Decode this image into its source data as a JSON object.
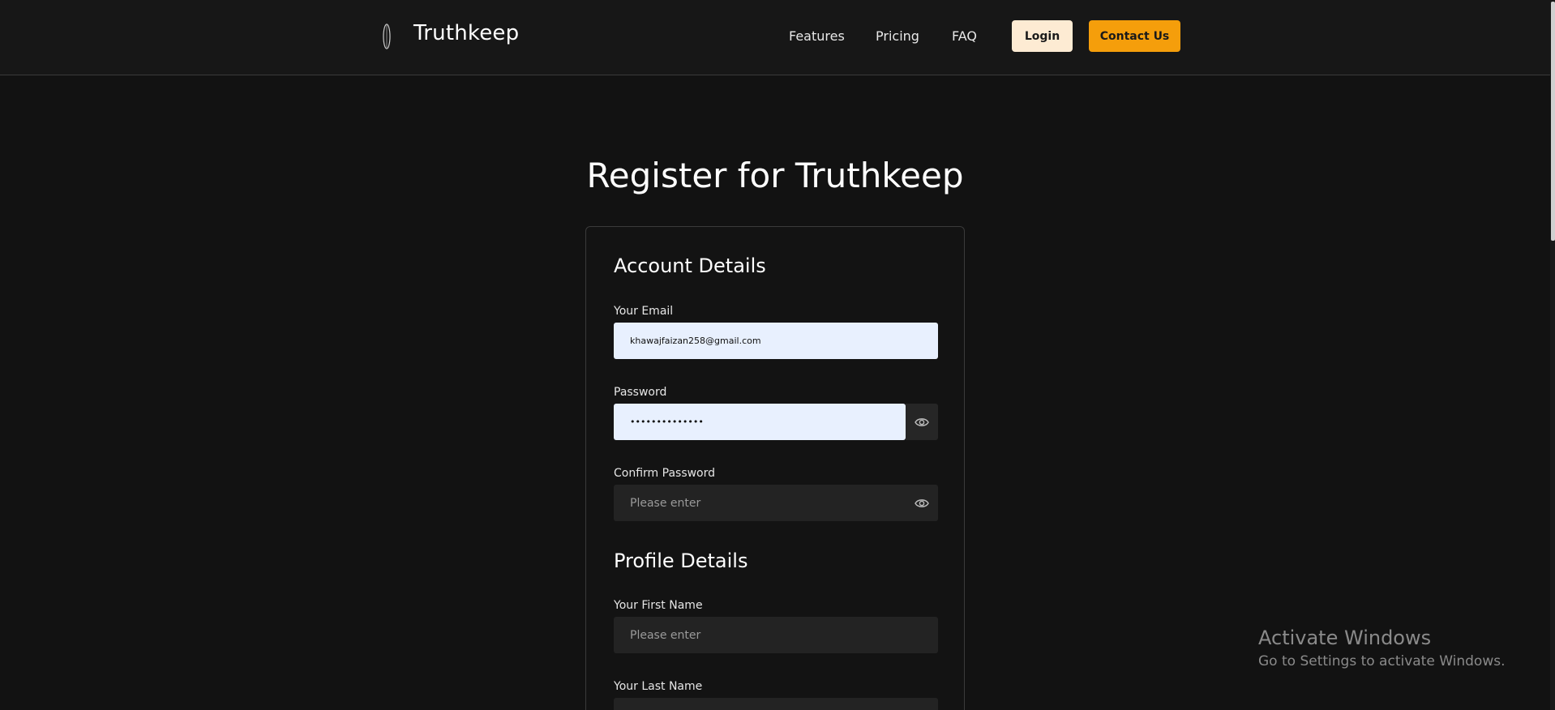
{
  "header": {
    "brand": "Truthkeep",
    "nav": [
      "Features",
      "Pricing",
      "FAQ"
    ],
    "login_label": "Login",
    "contact_label": "Contact Us"
  },
  "main": {
    "title": "Register for Truthkeep",
    "account_section": "Account Details",
    "email_label": "Your Email",
    "email_value": "khawajfaizan258@gmail.com",
    "password_label": "Password",
    "password_value": "••••••••••••••",
    "confirm_label": "Confirm Password",
    "confirm_placeholder": "Please enter",
    "profile_section": "Profile Details",
    "first_name_label": "Your First Name",
    "first_name_placeholder": "Please enter",
    "last_name_label": "Your Last Name"
  },
  "watermark": {
    "title": "Activate Windows",
    "subtitle": "Go to Settings to activate Windows."
  },
  "colors": {
    "background": "#121212",
    "accent": "#f59e0b",
    "login_bg": "#fdebd3",
    "autofill_bg": "#e8f0fe",
    "input_bg": "#232323"
  },
  "icons": {
    "logo": "feather-logo-icon",
    "password_toggle": "eye-icon"
  }
}
